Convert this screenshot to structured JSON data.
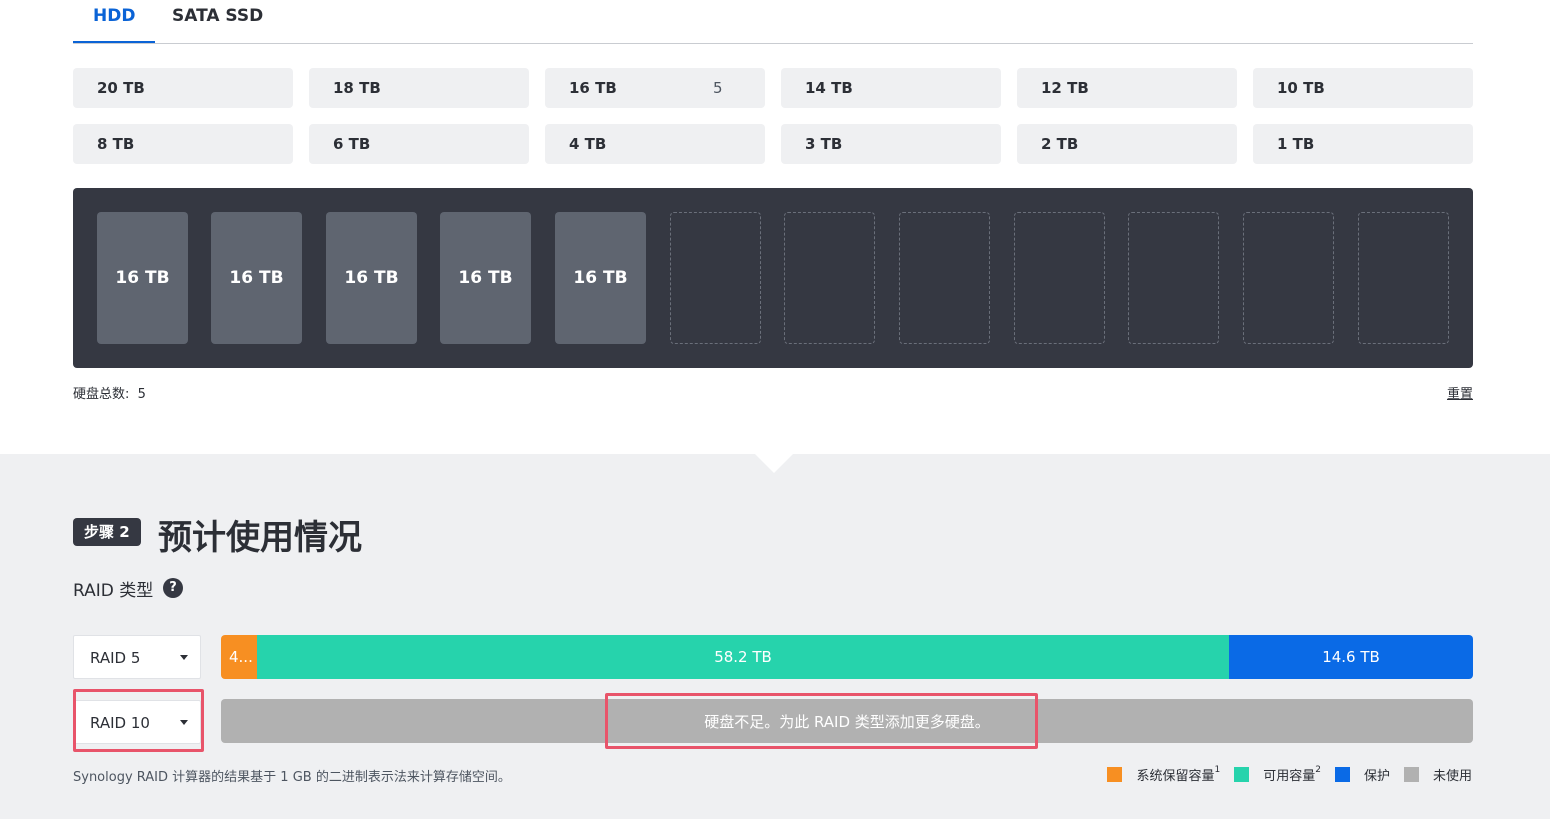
{
  "tabs": [
    {
      "label": "HDD",
      "active": true
    },
    {
      "label": "SATA SSD",
      "active": false
    }
  ],
  "capacities": [
    {
      "label": "20 TB",
      "count": ""
    },
    {
      "label": "18 TB",
      "count": ""
    },
    {
      "label": "16 TB",
      "count": "5"
    },
    {
      "label": "14 TB",
      "count": ""
    },
    {
      "label": "12 TB",
      "count": ""
    },
    {
      "label": "10 TB",
      "count": ""
    },
    {
      "label": "8 TB",
      "count": ""
    },
    {
      "label": "6 TB",
      "count": ""
    },
    {
      "label": "4 TB",
      "count": ""
    },
    {
      "label": "3 TB",
      "count": ""
    },
    {
      "label": "2 TB",
      "count": ""
    },
    {
      "label": "1 TB",
      "count": ""
    }
  ],
  "bay": {
    "slots": [
      "16 TB",
      "16 TB",
      "16 TB",
      "16 TB",
      "16 TB",
      "",
      "",
      "",
      "",
      "",
      "",
      ""
    ]
  },
  "total": {
    "label": "硬盘总数:",
    "value": "5"
  },
  "reset_label": "重置",
  "step": {
    "badge": "步骤 2",
    "title": "预计使用情况"
  },
  "raid_type_label": "RAID 类型",
  "help_label": "?",
  "raid_rows": [
    {
      "select": "RAID 5",
      "segments": [
        {
          "label": "4...",
          "color": "#f78f22"
        },
        {
          "label": "58.2 TB",
          "color": "#26d3ac"
        },
        {
          "label": "14.6 TB",
          "color": "#0a6ae6"
        }
      ]
    },
    {
      "select": "RAID 10",
      "message": "硬盘不足。为此 RAID 类型添加更多硬盘。"
    }
  ],
  "note": "Synology RAID 计算器的结果基于 1 GB 的二进制表示法来计算存储空间。",
  "legend": [
    {
      "label": "系统保留容量",
      "sup": "1",
      "color": "#f78f22"
    },
    {
      "label": "可用容量",
      "sup": "2",
      "color": "#26d3ac"
    },
    {
      "label": "保护",
      "sup": "",
      "color": "#0a6ae6"
    },
    {
      "label": "未使用",
      "sup": "",
      "color": "#b1b1b1"
    }
  ]
}
